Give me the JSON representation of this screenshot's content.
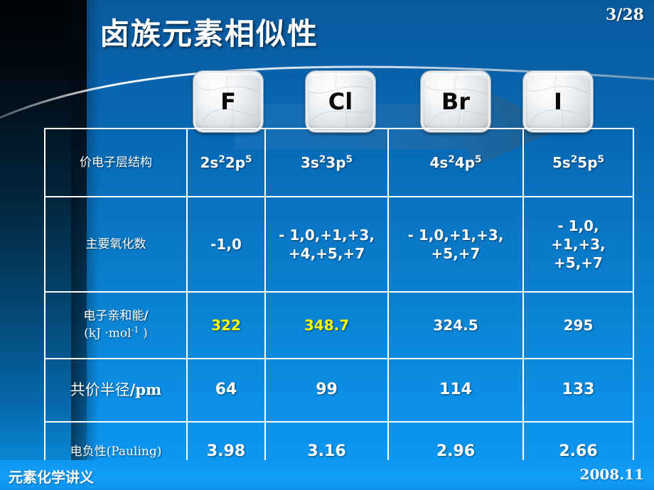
{
  "slide": {
    "title": "卤族元素相似性",
    "page_number": "3/28",
    "footer_left": "元素化学讲义",
    "footer_right": "2008.11",
    "accent_color": "#0b8ad8",
    "highlight_color": "#ffff00",
    "tile_text_color": "#0a0a0a"
  },
  "elements": [
    {
      "symbol": "F",
      "name": "element-tile-f"
    },
    {
      "symbol": "Cl",
      "name": "element-tile-cl"
    },
    {
      "symbol": "Br",
      "name": "element-tile-br"
    },
    {
      "symbol": "I",
      "name": "element-tile-i"
    }
  ],
  "table": {
    "rows": [
      {
        "label_html": "价电子层结构",
        "label_style": "serif",
        "cells": [
          {
            "html": "2s<sup>2</sup>2p<sup>5</sup>",
            "highlight": false
          },
          {
            "html": "3s<sup>2</sup>3p<sup>5</sup>",
            "highlight": false
          },
          {
            "html": "4s<sup>2</sup>4p<sup>5</sup>",
            "highlight": false
          },
          {
            "html": "5s<sup>2</sup>5p<sup>5</sup>",
            "highlight": false
          }
        ]
      },
      {
        "label_html": "主要氧化数",
        "label_style": "serif",
        "cells": [
          {
            "html": "-1,0",
            "highlight": false
          },
          {
            "html": "- 1,0,+1,+3,<br>+4,+5,+7",
            "highlight": false
          },
          {
            "html": "- 1,0,+1,+3,<br>+5,+7",
            "highlight": false
          },
          {
            "html": "- 1,0,<br>+1,+3,<br>+5,+7",
            "highlight": false
          }
        ]
      },
      {
        "label_html": "电子亲和能<b>/</b><br>(kJ ·mol<sup>-1</sup> )",
        "label_style": "serif",
        "cells": [
          {
            "html": "322",
            "highlight": true
          },
          {
            "html": "348.7",
            "highlight": true
          },
          {
            "html": "324.5",
            "highlight": false
          },
          {
            "html": "295",
            "highlight": false
          }
        ]
      },
      {
        "label_html": "共价半径<b>/pm</b>",
        "label_style": "serif-big",
        "cells": [
          {
            "html": "64",
            "highlight": false
          },
          {
            "html": "99",
            "highlight": false
          },
          {
            "html": "114",
            "highlight": false
          },
          {
            "html": "133",
            "highlight": false
          }
        ]
      },
      {
        "label_html": "电负性(Pauling)",
        "label_style": "serif",
        "cells": [
          {
            "html": "3.98",
            "highlight": false
          },
          {
            "html": "3.16",
            "highlight": false
          },
          {
            "html": "2.96",
            "highlight": false
          },
          {
            "html": "2.66",
            "highlight": false
          }
        ]
      }
    ]
  }
}
